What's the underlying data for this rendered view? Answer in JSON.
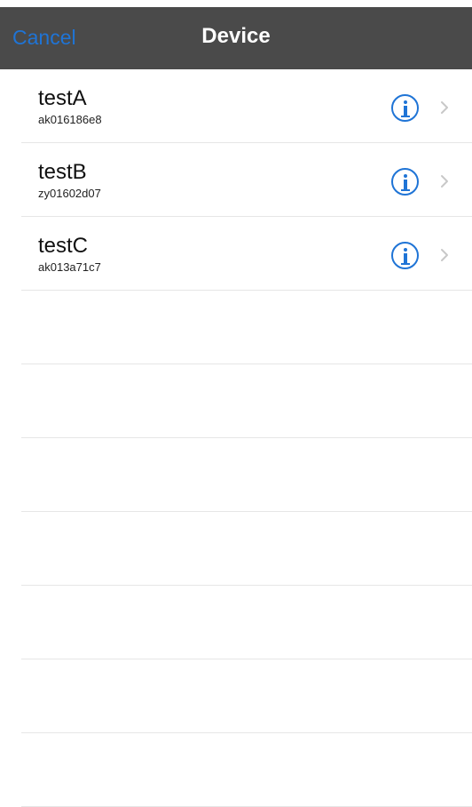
{
  "navbar": {
    "cancel_label": "Cancel",
    "title": "Device"
  },
  "devices": [
    {
      "name": "testA",
      "id": "ak016186e8",
      "info_icon": "info-icon",
      "chevron_icon": "chevron-right-icon"
    },
    {
      "name": "testB",
      "id": "zy01602d07",
      "info_icon": "info-icon",
      "chevron_icon": "chevron-right-icon"
    },
    {
      "name": "testC",
      "id": "ak013a71c7",
      "info_icon": "info-icon",
      "chevron_icon": "chevron-right-icon"
    }
  ],
  "colors": {
    "navbar_background": "#4a4a4a",
    "accent": "#1f74d6",
    "separator": "#e6e6e6",
    "background": "#ffffff"
  }
}
